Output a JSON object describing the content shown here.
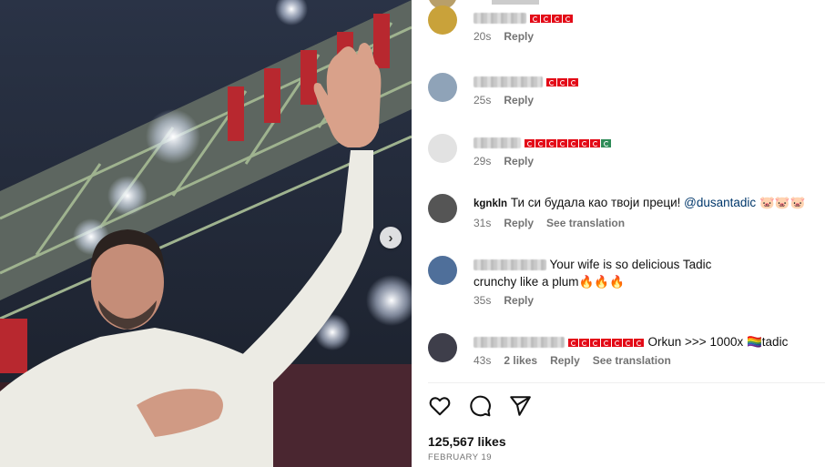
{
  "photo": {
    "alt_icon": "chevron-right-icon"
  },
  "comments": [
    {
      "username": "",
      "text": "",
      "time": "20s",
      "likes": "",
      "reply": "Reply",
      "translate": ""
    },
    {
      "username": "",
      "text": "",
      "time": "25s",
      "likes": "",
      "reply": "Reply",
      "translate": ""
    },
    {
      "username": "",
      "text": "",
      "time": "29s",
      "likes": "",
      "reply": "Reply",
      "translate": ""
    },
    {
      "username": "kgnkln",
      "text": "Ти си будала као твоји преци! ",
      "mention": "@dusantadic",
      "emoji": "🐷🐷🐷",
      "time": "31s",
      "reply": "Reply",
      "translate": "See translation"
    },
    {
      "username": "",
      "text": "Your wife is so delicious Tadic crunchy like a plum",
      "emoji": "🔥🔥🔥",
      "time": "35s",
      "reply": "Reply",
      "translate": ""
    },
    {
      "username": "",
      "text": "Orkun >>> 1000x ",
      "emoji": "🏳️‍🌈",
      "text2": "tadic",
      "time": "43s",
      "likes": "2 likes",
      "reply": "Reply",
      "translate": "See translation"
    }
  ],
  "actions": {
    "like_icon": "heart-icon",
    "comment_icon": "comment-icon",
    "share_icon": "send-icon"
  },
  "likes_count": "125,567 likes",
  "post_date": "FEBRUARY 19",
  "colors": {
    "flag_red": "#e30a17",
    "meta_gray": "#737373",
    "mention_blue": "#00376b"
  }
}
